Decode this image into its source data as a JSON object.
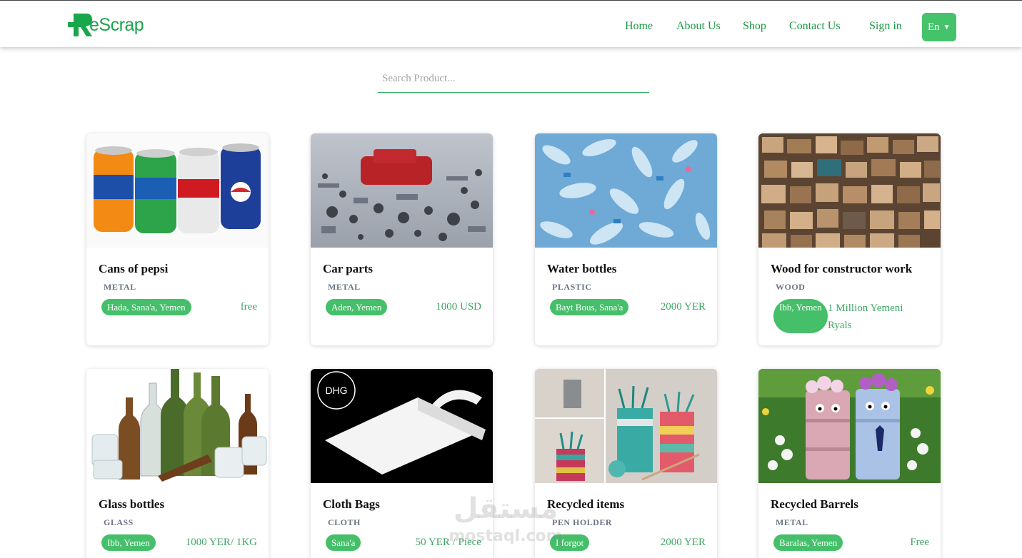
{
  "brand": {
    "logo_text": "eScrap",
    "accent": "#1aa64b",
    "chip": "#45bf6a"
  },
  "nav": {
    "home": "Home",
    "about": "About Us",
    "shop": "Shop",
    "contact": "Contact Us",
    "signin": "Sign in",
    "language": "En"
  },
  "search": {
    "placeholder": "Search Product...",
    "value": ""
  },
  "products": [
    {
      "title": "Cans of pepsi",
      "category": "METAL",
      "location": "Hada, Sana'a, Yemen",
      "price": "free"
    },
    {
      "title": "Car parts",
      "category": "METAL",
      "location": "Aden, Yemen",
      "price": "1000 USD"
    },
    {
      "title": "Water bottles",
      "category": "PLASTIC",
      "location": "Bayt Bous, Sana'a",
      "price": "2000 YER"
    },
    {
      "title": "Wood for constructor work",
      "category": "WOOD",
      "location": "Ibb, Yemen",
      "price": "1 Million Yemeni Ryals"
    },
    {
      "title": "Glass bottles",
      "category": "GLASS",
      "location": "Ibb, Yemen",
      "price": "1000 YER/ 1KG"
    },
    {
      "title": "Cloth Bags",
      "category": "CLOTH",
      "location": "Sana'a",
      "price": "50 YER / Piece"
    },
    {
      "title": "Recycled items",
      "category": "PEN HOLDER",
      "location": "I forgot",
      "price": "2000 YER"
    },
    {
      "title": "Recycled Barrels",
      "category": "METAL",
      "location": "Baralas, Yemen",
      "price": "Free"
    }
  ],
  "watermark": {
    "text_ar": "مستقل",
    "text_en": "mostaql.com"
  }
}
